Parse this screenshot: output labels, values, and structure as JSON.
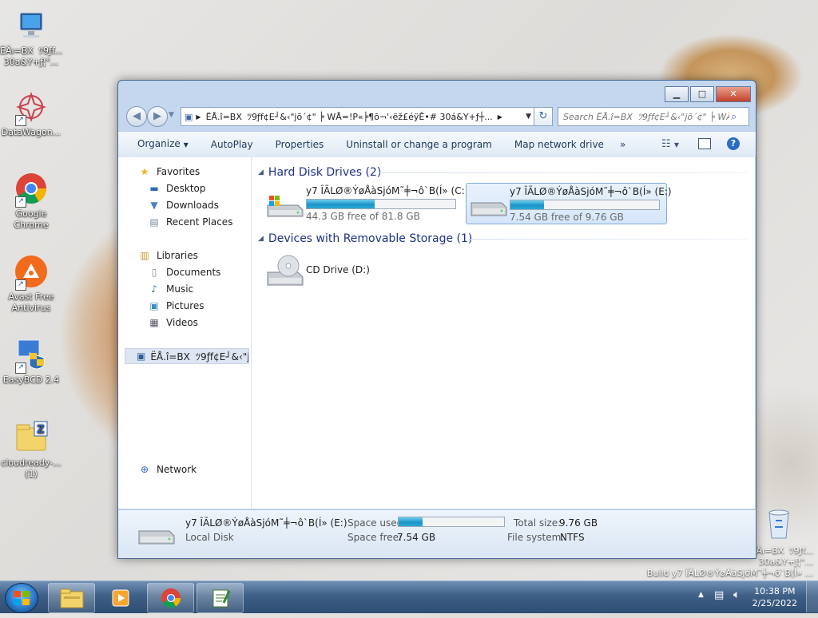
{
  "desktop": {
    "icons": [
      {
        "label": "ËÅı=BXﾂ9ƒf...\n30a&Y+ƒ¦\"...",
        "icon": "computer-icon"
      },
      {
        "label": "DataWagon...",
        "icon": "datawagon-icon"
      },
      {
        "label": "Google\nChrome",
        "icon": "chrome-icon"
      },
      {
        "label": "Avast Free\nAntivirus",
        "icon": "avast-icon"
      },
      {
        "label": "EasyBCD 2.4",
        "icon": "easybcd-icon"
      },
      {
        "label": "cloudready-...\n(1)",
        "icon": "zip-folder-icon"
      }
    ],
    "recycle_bin_icon": "recycle-bin-icon",
    "watermark": {
      "line1": "ËÅı=BXﾂ9ƒf...",
      "line2": "30a&Y+ƒ¦\"...",
      "line3": "Build y7 ÎÃLØ®ÝøÅàSjóM˜╪¬ô`B(Í» ..."
    }
  },
  "window": {
    "address_path": "ËÅ.î=BXﾂ9ƒf¢E┘&‹\"jõ´¢\" ╞ WÅ=!P«╞¶õ¬'‹ëž£éÿÊ•# 30á&Y+ƒ┼...",
    "search_placeholder": "Search ËÅ.î=BXﾂ9ƒf¢E┘&‹\"jõ´¢\" ╞ WÅ=!...",
    "toolbar": {
      "organize": "Organize",
      "autoplay": "AutoPlay",
      "properties": "Properties",
      "uninstall": "Uninstall or change a program",
      "map_network": "Map network drive",
      "more": "»"
    },
    "nav": {
      "favorites": "Favorites",
      "desktop": "Desktop",
      "downloads": "Downloads",
      "recent": "Recent Places",
      "libraries": "Libraries",
      "documents": "Documents",
      "music": "Music",
      "pictures": "Pictures",
      "videos": "Videos",
      "computer": "ËÅ.î=BXﾂ9ƒf¢E┘&‹\"jõ´",
      "network": "Network"
    },
    "groups": {
      "hdd": "Hard Disk Drives (2)",
      "removable": "Devices with Removable Storage (1)"
    },
    "drives": [
      {
        "name": "y7 ÎÃLØ®ÝøÅàSjóM˜╪¬ô`B(Í» (C:)",
        "free_text": "44.3 GB free of 81.8 GB",
        "used_fraction": 0.458
      },
      {
        "name": "y7 ÎÃLØ®ÝøÅàSjóM˜╪¬ô`B(Í» (E:)",
        "free_text": "7.54 GB free of 9.76 GB",
        "used_fraction": 0.227
      }
    ],
    "cd_drive": "CD Drive (D:)",
    "details": {
      "name": "y7 ÎÃLØ®ÝøÅàSjóM˜╪¬ô`B(Í» (E:)",
      "type": "Local Disk",
      "space_used_label": "Space used:",
      "space_free_label": "Space free:",
      "space_free_value": "7.54 GB",
      "total_size_label": "Total size:",
      "total_size_value": "9.76 GB",
      "file_system_label": "File system:",
      "file_system_value": "NTFS",
      "used_fraction": 0.227
    }
  },
  "taskbar": {
    "time": "10:38 PM",
    "date": "2/25/2022"
  }
}
